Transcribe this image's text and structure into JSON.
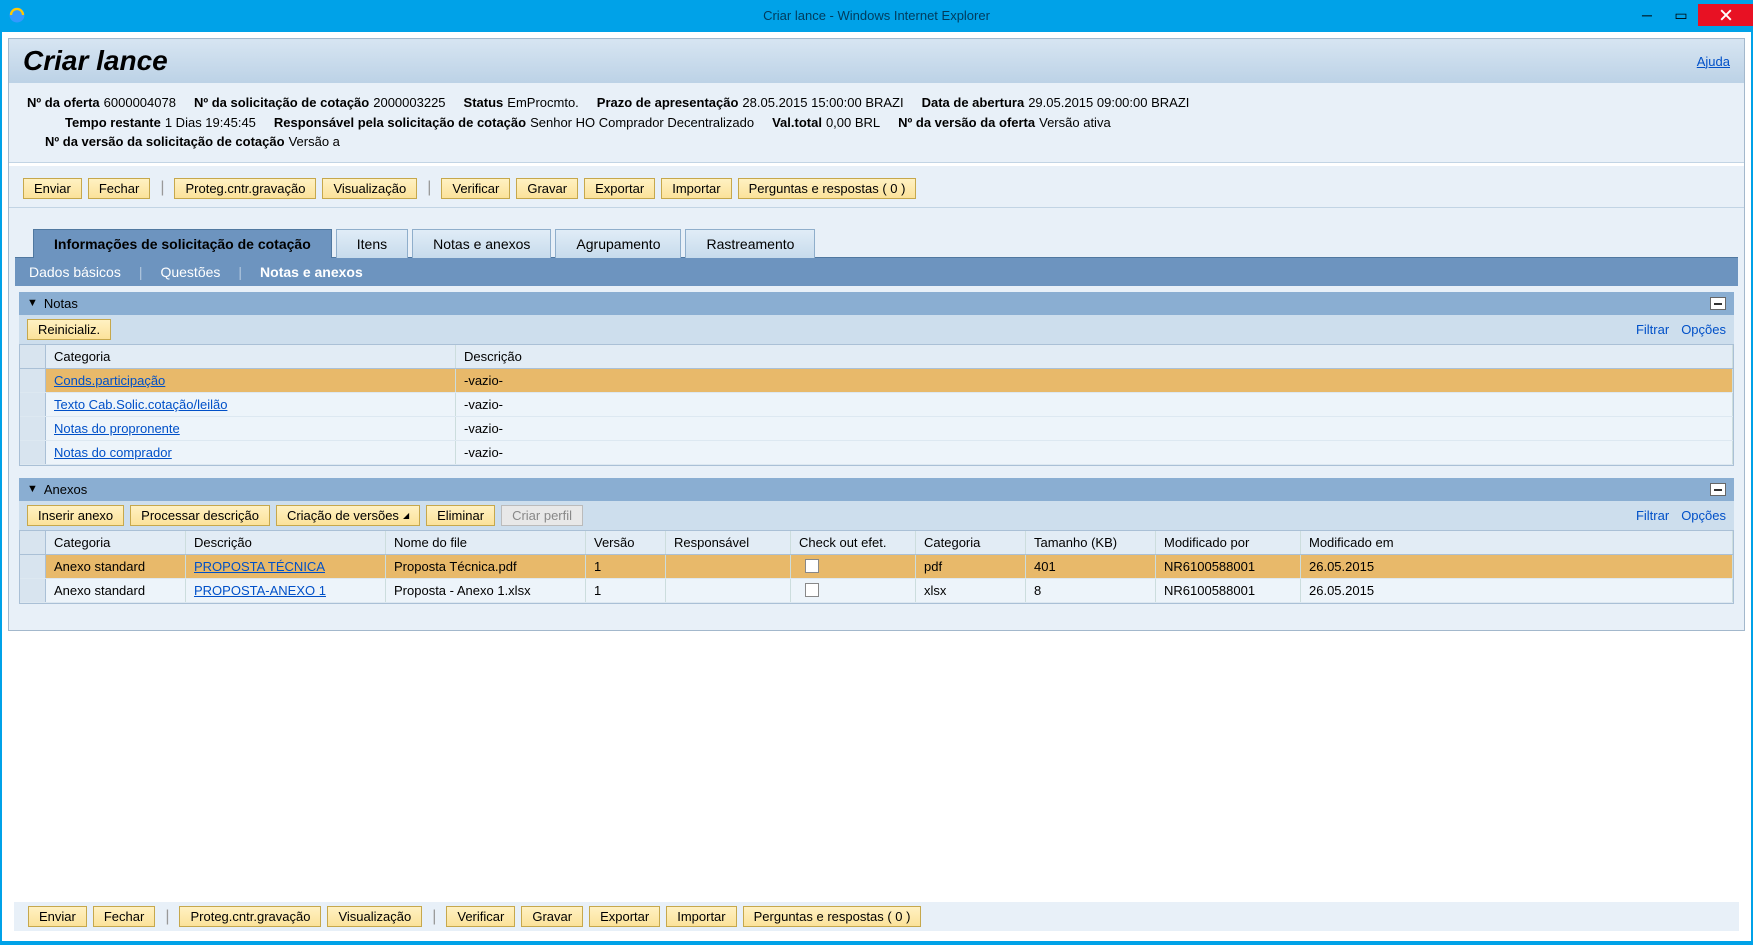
{
  "window": {
    "title": "Criar lance - Windows Internet Explorer"
  },
  "page": {
    "title": "Criar lance",
    "help": "Ajuda"
  },
  "info": {
    "offer_no_label": "Nº da oferta",
    "offer_no": "6000004078",
    "rfq_no_label": "Nº da solicitação de cotação",
    "rfq_no": "2000003225",
    "status_label": "Status",
    "status": "EmProcmto.",
    "deadline_label": "Prazo de apresentação",
    "deadline": "28.05.2015 15:00:00 BRAZI",
    "open_date_label": "Data de abertura",
    "open_date": "29.05.2015 09:00:00 BRAZI",
    "time_left_label": "Tempo restante",
    "time_left": "1 Dias 19:45:45",
    "responsible_label": "Responsável pela solicitação de cotação",
    "responsible": "Senhor HO Comprador Decentralizado",
    "total_label": "Val.total",
    "total": "0,00 BRL",
    "offer_ver_label": "Nº da versão da oferta",
    "offer_ver": "Versão ativa",
    "rfq_ver_label": "Nº da versão da solicitação de cotação",
    "rfq_ver": "Versão a"
  },
  "buttons": {
    "enviar": "Enviar",
    "fechar": "Fechar",
    "proteg": "Proteg.cntr.gravação",
    "visual": "Visualização",
    "verificar": "Verificar",
    "gravar": "Gravar",
    "exportar": "Exportar",
    "importar": "Importar",
    "qa": "Perguntas e respostas ( 0 )"
  },
  "tabs": {
    "info": "Informações de solicitação de cotação",
    "itens": "Itens",
    "notas": "Notas e anexos",
    "agrup": "Agrupamento",
    "rastr": "Rastreamento"
  },
  "subtabs": {
    "dados": "Dados básicos",
    "questoes": "Questões",
    "notas": "Notas e anexos"
  },
  "notes_section": {
    "title": "Notas",
    "reset": "Reinicializ.",
    "filtrar": "Filtrar",
    "opcoes": "Opções",
    "headers": {
      "categoria": "Categoria",
      "descricao": "Descrição"
    },
    "rows": [
      {
        "cat": "Conds.participação",
        "desc": "-vazio-"
      },
      {
        "cat": "Texto Cab.Solic.cotação/leilão",
        "desc": "-vazio-"
      },
      {
        "cat": "Notas do propronente",
        "desc": "-vazio-"
      },
      {
        "cat": "Notas do comprador",
        "desc": "-vazio-"
      }
    ]
  },
  "attach_section": {
    "title": "Anexos",
    "inserir": "Inserir anexo",
    "processar": "Processar descrição",
    "versoes": "Criação de versões",
    "eliminar": "Eliminar",
    "criar_perfil": "Criar perfil",
    "filtrar": "Filtrar",
    "opcoes": "Opções",
    "headers": {
      "categoria": "Categoria",
      "descricao": "Descrição",
      "nome_file": "Nome do file",
      "versao": "Versão",
      "responsavel": "Responsável",
      "checkout": "Check out efet.",
      "cat2": "Categoria",
      "tamanho": "Tamanho (KB)",
      "modby": "Modificado por",
      "modon": "Modificado em"
    },
    "rows": [
      {
        "cat": "Anexo standard",
        "desc": "PROPOSTA TÉCNICA",
        "file": "Proposta Técnica.pdf",
        "ver": "1",
        "resp": "",
        "check": false,
        "catg": "pdf",
        "size": "401",
        "modby": "NR6100588001",
        "modon": "26.05.2015"
      },
      {
        "cat": "Anexo standard",
        "desc": "PROPOSTA-ANEXO 1",
        "file": "Proposta - Anexo 1.xlsx",
        "ver": "1",
        "resp": "",
        "check": false,
        "catg": "xlsx",
        "size": "8",
        "modby": "NR6100588001",
        "modon": "26.05.2015"
      }
    ]
  }
}
